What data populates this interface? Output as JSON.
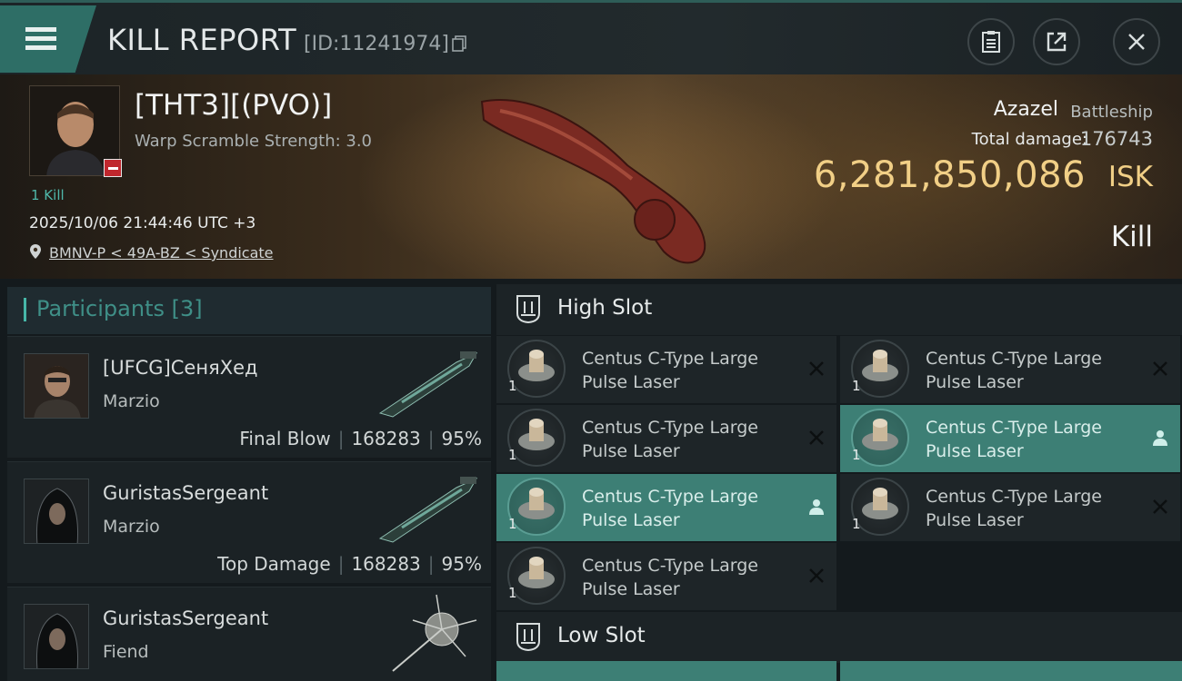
{
  "header": {
    "title": "KILL REPORT",
    "report_id": "[ID:11241974]"
  },
  "victim": {
    "name": "[THT3][(PVO)]",
    "warp_scramble": "Warp Scramble Strength: 3.0",
    "kill_count": "1 Kill",
    "datetime": "2025/10/06 21:44:46 UTC +3",
    "location": "BMNV-P < 49A-BZ < Syndicate",
    "ship_name": "Azazel",
    "ship_class": "Battleship",
    "total_damage_label": "Total damage:",
    "total_damage": "176743",
    "isk_value": "6,281,850,086",
    "isk_unit": "ISK",
    "result": "Kill"
  },
  "participants": {
    "label": "Participants",
    "count": "[3]",
    "items": [
      {
        "name": "[UFCG]СеняХед",
        "ship": "Marzio",
        "role": "Final Blow",
        "damage": "168283",
        "percent": "95%"
      },
      {
        "name": "GuristasSergeant",
        "ship": "Marzio",
        "role": "Top Damage",
        "damage": "168283",
        "percent": "95%"
      },
      {
        "name": "GuristasSergeant",
        "ship": "Fiend"
      }
    ]
  },
  "slots": {
    "high": {
      "label": "High Slot",
      "modules": [
        {
          "name": "Centus C-Type Large Pulse Laser",
          "qty": "1",
          "state": "destroyed"
        },
        {
          "name": "Centus C-Type Large Pulse Laser",
          "qty": "1",
          "state": "destroyed"
        },
        {
          "name": "Centus C-Type Large Pulse Laser",
          "qty": "1",
          "state": "destroyed"
        },
        {
          "name": "Centus C-Type Large Pulse Laser",
          "qty": "1",
          "state": "dropped"
        },
        {
          "name": "Centus C-Type Large Pulse Laser",
          "qty": "1",
          "state": "dropped"
        },
        {
          "name": "Centus C-Type Large Pulse Laser",
          "qty": "1",
          "state": "destroyed"
        },
        {
          "name": "Centus C-Type Large Pulse Laser",
          "qty": "1",
          "state": "destroyed"
        }
      ]
    },
    "low": {
      "label": "Low Slot"
    }
  },
  "colors": {
    "accent": "#46b7a8",
    "highlight": "#3d7f75",
    "isk_gold": "#f1cf86",
    "danger": "#c0272d"
  },
  "icons": [
    "menu-icon",
    "copy-icon",
    "clipboard-icon",
    "share-icon",
    "close-icon",
    "location-pin-icon",
    "slot-icon",
    "destroyed-x-icon",
    "dropped-person-icon"
  ]
}
